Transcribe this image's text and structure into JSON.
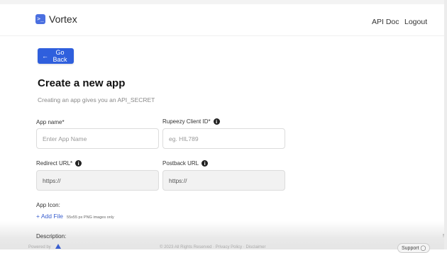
{
  "app": {
    "name": "Vortex",
    "logo_glyph": ">_"
  },
  "nav": {
    "api_doc": "API Doc",
    "logout": "Logout"
  },
  "back_button": {
    "arrow": "←",
    "label": "Go Back"
  },
  "page": {
    "title": "Create a new app",
    "subtitle": "Creating an app gives you an API_SECRET"
  },
  "form": {
    "app_name": {
      "label": "App name*",
      "placeholder": "Enter App Name"
    },
    "client_id": {
      "label": "Rupeezy Client ID*",
      "placeholder": "eg. HIL789",
      "info_icon": "i"
    },
    "redirect_url": {
      "label": "Redirect URL*",
      "value": "https://",
      "info_icon": "i"
    },
    "postback_url": {
      "label": "Postback URL",
      "value": "https://",
      "info_icon": "i"
    },
    "app_icon": {
      "label": "App Icon:",
      "add_file": "+ Add File",
      "hint": "55x55 px PNG images only"
    },
    "description": {
      "label": "Description:"
    }
  },
  "footer": {
    "left": "Powered by",
    "center": "© 2023 All Rights Reserved · Privacy Policy · Disclaimer",
    "support": "Support ◯"
  },
  "colors": {
    "accent": "#2f5fdd",
    "link": "#3a5fcf",
    "text": "#222222"
  }
}
